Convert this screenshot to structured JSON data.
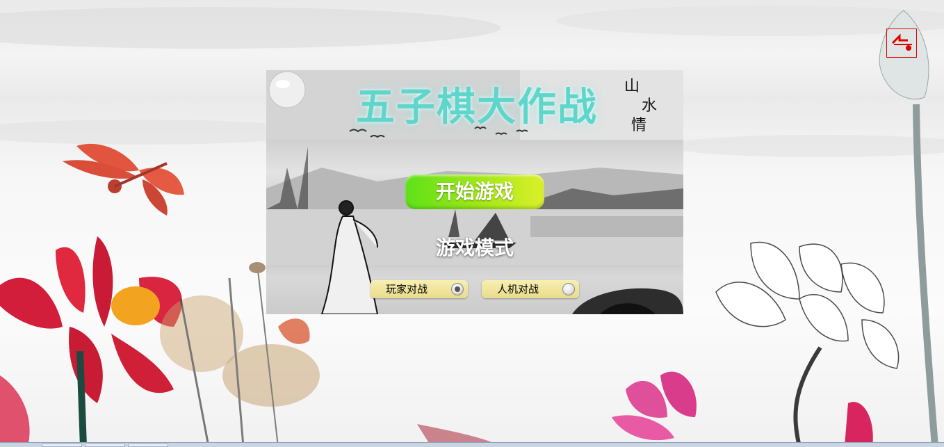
{
  "game": {
    "title": "五子棋大作战",
    "calligraphy": "山水情"
  },
  "menu": {
    "start_label": "开始游戏",
    "mode_label": "游戏模式",
    "modes": [
      {
        "label": "玩家对战",
        "selected": true
      },
      {
        "label": "人机对战",
        "selected": false
      }
    ]
  },
  "corner": {
    "icon": "back-arrow-icon"
  },
  "colors": {
    "title": "#5fd6cc",
    "start_button_left": "#5fe11a",
    "start_button_right": "#dcef2a",
    "option_bg": "#f0e6a0",
    "corner_border": "#e00000"
  }
}
